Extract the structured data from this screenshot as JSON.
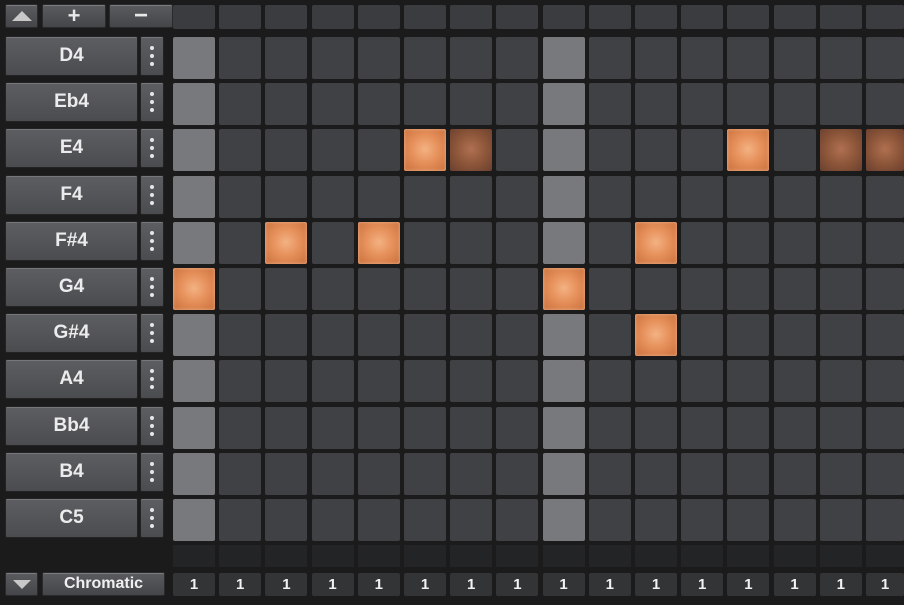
{
  "toolbar": {
    "up_icon": "triangle-up-icon",
    "plus_label": "+",
    "minus_label": "−"
  },
  "notes": [
    "D4",
    "Eb4",
    "E4",
    "F4",
    "F#4",
    "G4",
    "G#4",
    "A4",
    "Bb4",
    "B4",
    "C5"
  ],
  "steps": 16,
  "beat_steps": [
    0,
    8
  ],
  "active": {
    "2": {
      "on": [
        5,
        12
      ],
      "dim": [
        6,
        14,
        15
      ]
    },
    "4": {
      "on": [
        2,
        4,
        10
      ],
      "dim": []
    },
    "5": {
      "on": [
        0,
        8
      ],
      "dim": []
    },
    "6": {
      "on": [
        10
      ],
      "dim": []
    }
  },
  "footer": {
    "scale_label": "Chromatic",
    "step_values": [
      "1",
      "1",
      "1",
      "1",
      "1",
      "1",
      "1",
      "1",
      "1",
      "1",
      "1",
      "1",
      "1",
      "1",
      "1",
      "1"
    ]
  },
  "colors": {
    "active_cell": "#e6905b",
    "beat_cell": "#77797c",
    "cell": "#3f4144"
  }
}
